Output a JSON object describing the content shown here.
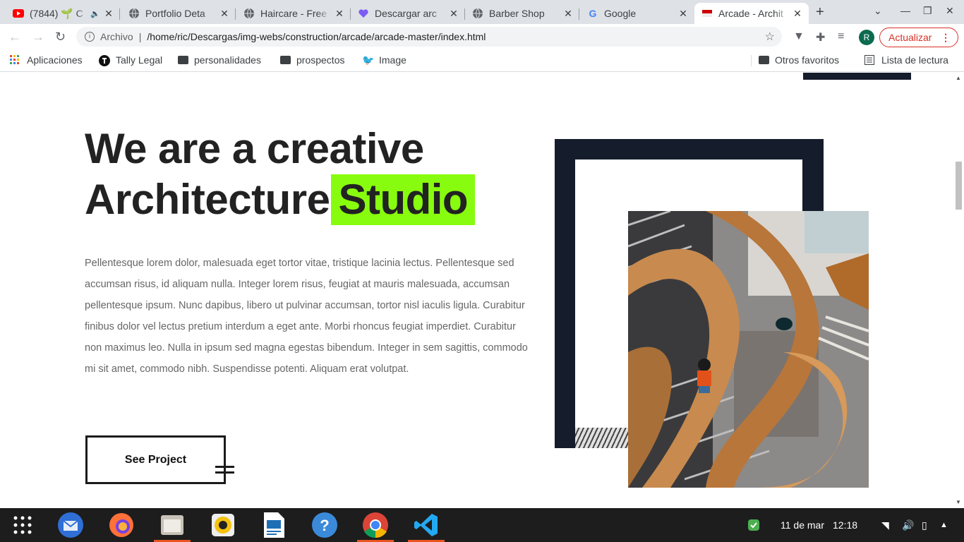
{
  "browser": {
    "tabs": [
      {
        "title": "(7844) 🌱 C",
        "icon": "youtube-icon"
      },
      {
        "title": "Portfolio Deta",
        "icon": "globe-icon"
      },
      {
        "title": "Haircare - Free",
        "icon": "globe-icon"
      },
      {
        "title": "Descargar arc",
        "icon": "heart-icon"
      },
      {
        "title": "Barber Shop",
        "icon": "globe-icon"
      },
      {
        "title": "Google",
        "icon": "google-icon"
      },
      {
        "title": "Arcade - Archit",
        "icon": "flag-icon"
      }
    ],
    "new_tab": "+",
    "omnibox": {
      "archivo": "Archivo",
      "url": "/home/ric/Descargas/img-webs/construction/arcade/arcade-master/index.html"
    },
    "avatar_letter": "R",
    "update_label": "Actualizar",
    "bookmarks": [
      {
        "label": "Aplicaciones"
      },
      {
        "label": "Tally Legal"
      },
      {
        "label": "personalidades"
      },
      {
        "label": "prospectos"
      },
      {
        "label": "Image"
      }
    ],
    "other_favorites": "Otros favoritos",
    "reading_list": "Lista de lectura"
  },
  "page": {
    "headline_line1": "We are a creative",
    "headline_line2": "Architecture",
    "headline_highlight": "Studio",
    "paragraph": "Pellentesque lorem dolor, malesuada eget tortor vitae, tristique lacinia lectus. Pellentesque sed accumsan risus, id aliquam nulla. Integer lorem risus, feugiat at mauris malesuada, accumsan pellentesque ipsum. Nunc dapibus, libero ut pulvinar accumsan, tortor nisl iaculis ligula. Curabitur finibus dolor vel lectus pretium interdum a eget ante. Morbi rhoncus feugiat imperdiet. Curabitur non maximus leo. Nulla in ipsum sed magna egestas bibendum. Integer in sem sagittis, commodo mi sit amet, commodo nibh. Suspendisse potenti. Aliquam erat volutpat.",
    "button_label": "See Project",
    "accent_color": "#88fc0e",
    "frame_color": "#151c2b"
  },
  "taskbar": {
    "date": "11 de mar",
    "time": "12:18"
  }
}
